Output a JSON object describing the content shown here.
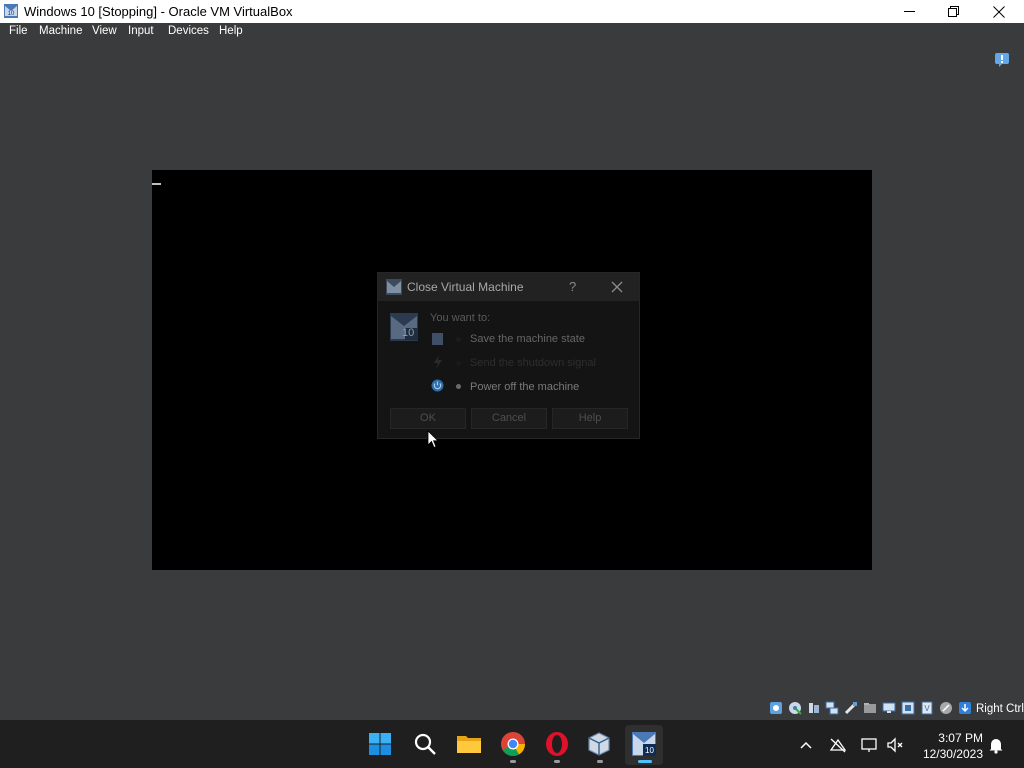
{
  "window": {
    "title": "Windows 10 [Stopping] - Oracle VM VirtualBox",
    "buttons": [
      "minimize",
      "maximize",
      "close"
    ]
  },
  "menu": [
    "File",
    "Machine",
    "View",
    "Input",
    "Devices",
    "Help"
  ],
  "dialog": {
    "title": "Close Virtual Machine",
    "help_glyph": "?",
    "prompt": "You want to:",
    "options": [
      {
        "label": "Save the machine state",
        "icon": "save-state-icon",
        "enabled": true
      },
      {
        "label": "Send the shutdown signal",
        "icon": "shutdown-signal-icon",
        "enabled": false
      },
      {
        "label": "Power off the machine",
        "icon": "power-icon",
        "enabled": true,
        "selected": true
      }
    ],
    "buttons": {
      "ok": "OK",
      "cancel": "Cancel",
      "help": "Help"
    },
    "os_badge": "10"
  },
  "statusbar": {
    "icons": [
      "hard-disk-icon",
      "optical-drive-icon",
      "audio-icon",
      "network-icon",
      "usb-icon",
      "shared-folders-icon",
      "display-icon",
      "video-capture-icon",
      "virtualization-icon",
      "mouse-integration-icon",
      "keyboard-icon"
    ],
    "host_key": "Right Ctrl"
  },
  "taskbar": {
    "apps": [
      "start-icon",
      "search-icon",
      "file-explorer-icon",
      "chrome-icon",
      "opera-icon",
      "virtualbox-icon",
      "vm-window-icon"
    ],
    "active_app": "vm-window-icon",
    "tray": [
      "chevron-up-icon",
      "network-disconnected-icon",
      "display-icon",
      "volume-icon"
    ],
    "time": "3:07 PM",
    "date": "12/30/2023"
  },
  "colors": {
    "window_bg": "#3a3b3d",
    "taskbar_bg": "#1f1f1f",
    "accent": "#4cc2ff"
  }
}
